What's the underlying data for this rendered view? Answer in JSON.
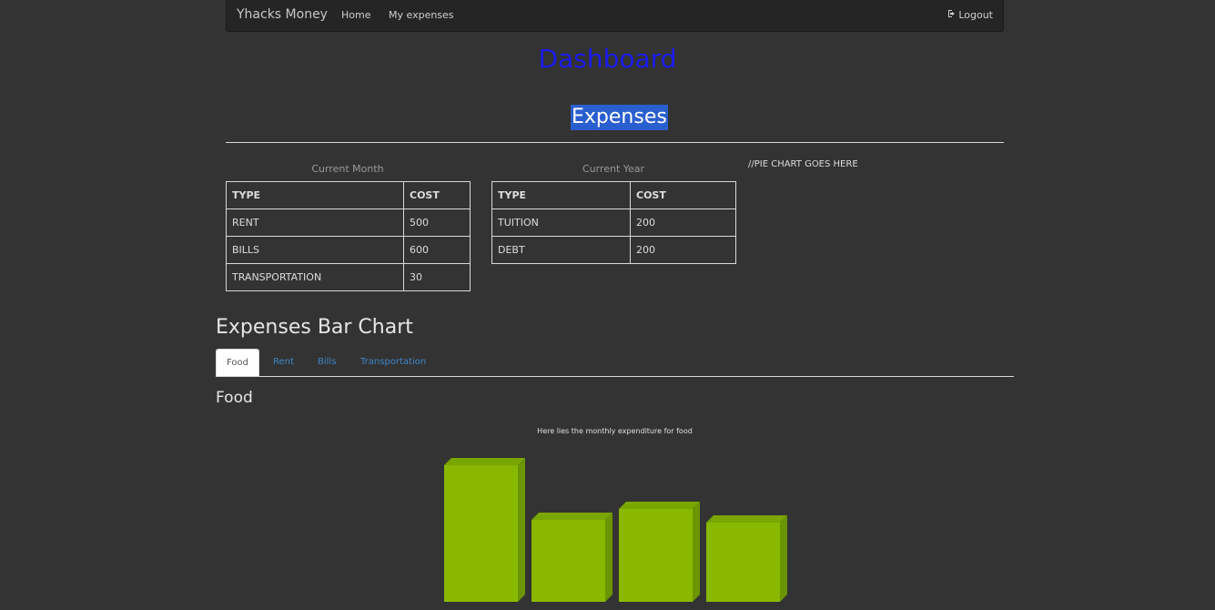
{
  "navbar": {
    "brand": "Yhacks Money",
    "links": [
      "Home",
      "My expenses"
    ],
    "logout": "Logout",
    "logout_icon": "logout-icon"
  },
  "page_title": "Dashboard",
  "expenses_heading": "Expenses",
  "current_month": {
    "caption": "Current Month",
    "headers": [
      "TYPE",
      "COST"
    ],
    "rows": [
      [
        "RENT",
        "500"
      ],
      [
        "BILLS",
        "600"
      ],
      [
        "TRANSPORTATION",
        "30"
      ]
    ]
  },
  "current_year": {
    "caption": "Current Year",
    "headers": [
      "TYPE",
      "COST"
    ],
    "rows": [
      [
        "TUITION",
        "200"
      ],
      [
        "DEBT",
        "200"
      ]
    ]
  },
  "pie_placeholder": "//PIE CHART GOES HERE",
  "bar_chart_heading": "Expenses Bar Chart",
  "tabs": [
    "Food",
    "Rent",
    "Bills",
    "Transportation"
  ],
  "active_tab": "Food",
  "section_title": "Food",
  "chart_data": {
    "type": "bar",
    "title": "Here lies the monthly expenditure for food",
    "values": [
      150,
      90,
      102,
      87
    ],
    "ylim": [
      0,
      160
    ],
    "color": "#8ab800",
    "color_top": "#7aa600",
    "color_side": "#6a9400"
  }
}
